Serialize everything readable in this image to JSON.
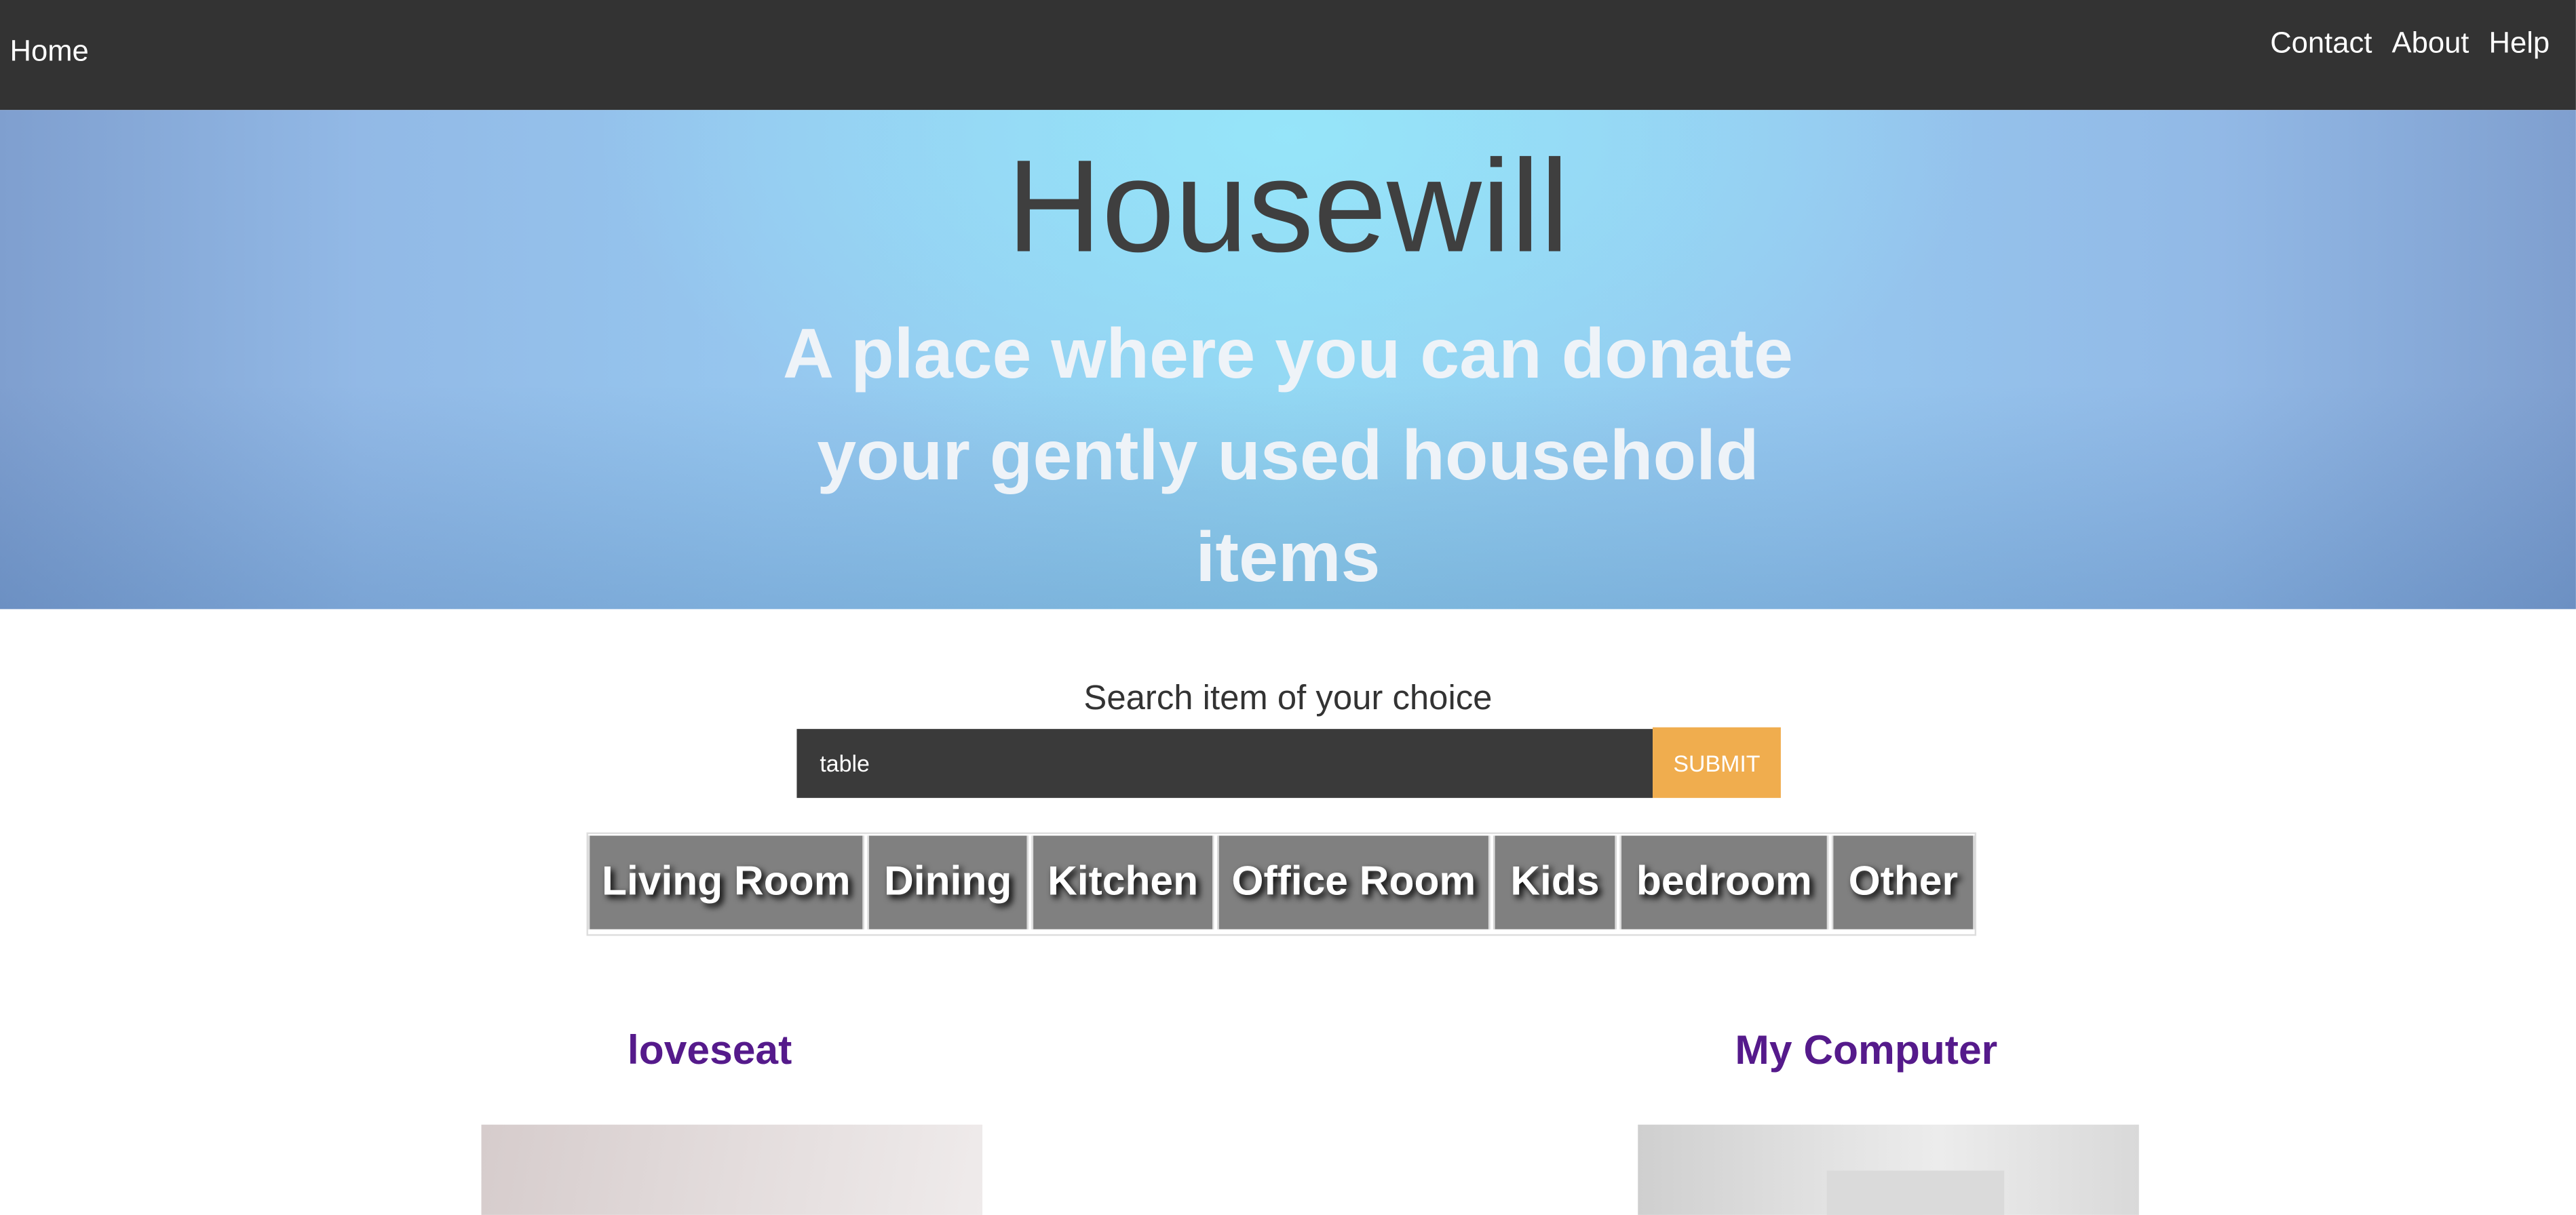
{
  "nav": {
    "home_label": "Home",
    "links": [
      "Contact",
      "About",
      "Help"
    ]
  },
  "hero": {
    "title": "Housewill",
    "tagline": "A place where you can donate your gently used household items"
  },
  "search": {
    "label": "Search item of your choice",
    "value": "table",
    "submit_label": "SUBMIT"
  },
  "categories": [
    "Living Room",
    "Dining",
    "Kitchen",
    "Office Room",
    "Kids",
    "bedroom",
    "Other"
  ],
  "items": [
    {
      "title": "loveseat"
    },
    {
      "title": "My Computer"
    }
  ],
  "colors": {
    "nav_bg": "#333333",
    "submit_bg": "#f0ad4e",
    "category_bg": "#808080",
    "item_title": "#551a8b"
  }
}
